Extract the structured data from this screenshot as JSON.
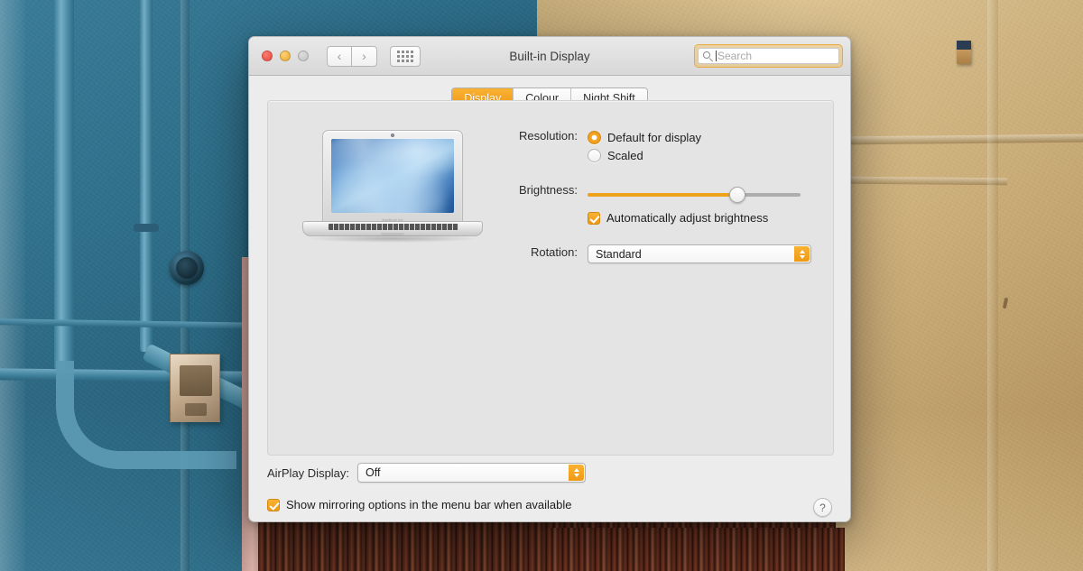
{
  "window": {
    "title": "Built-in Display",
    "traffic_lights": [
      "close",
      "minimize",
      "zoom"
    ],
    "nav": {
      "back": "‹",
      "forward": "›",
      "grid": "show-all"
    },
    "search": {
      "placeholder": "Search",
      "value": ""
    }
  },
  "tabs": [
    {
      "label": "Display",
      "active": true
    },
    {
      "label": "Colour",
      "active": false
    },
    {
      "label": "Night Shift",
      "active": false
    }
  ],
  "display": {
    "device_label": "MacBook Air",
    "resolution": {
      "label": "Resolution:",
      "options": [
        {
          "label": "Default for display",
          "selected": true
        },
        {
          "label": "Scaled",
          "selected": false
        }
      ]
    },
    "brightness": {
      "label": "Brightness:",
      "value": 72,
      "min": 0,
      "max": 100,
      "auto_adjust": {
        "label": "Automatically adjust brightness",
        "checked": true
      }
    },
    "rotation": {
      "label": "Rotation:",
      "value": "Standard"
    }
  },
  "footer": {
    "airplay": {
      "label": "AirPlay Display:",
      "value": "Off"
    },
    "mirroring": {
      "label": "Show mirroring options in the menu bar when available",
      "checked": true
    },
    "help": "?"
  },
  "colors": {
    "accent": "#f5a623",
    "accent_dark": "#ef9412",
    "window_bg": "#ececec",
    "panel_bg": "#e4e4e4",
    "wall_teal": "#246a87",
    "wall_ochre": "#cfae74"
  }
}
